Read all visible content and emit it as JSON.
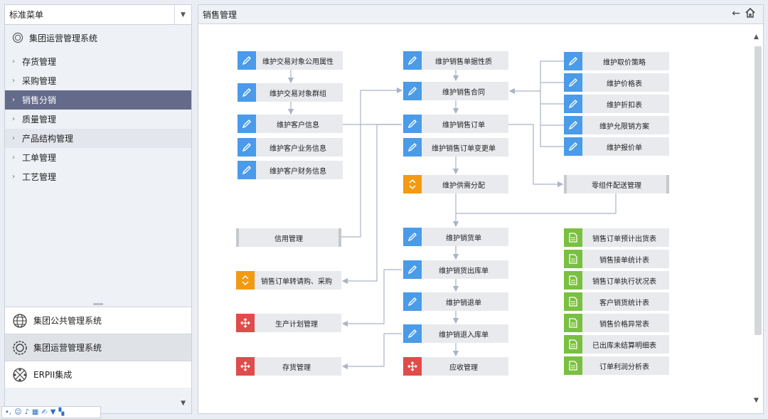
{
  "left_panel": {
    "menu_select": "标准菜单",
    "system_title": "集团运营管理系统",
    "tree": [
      {
        "label": "存货管理"
      },
      {
        "label": "采购管理"
      },
      {
        "label": "销售分销"
      },
      {
        "label": "质量管理"
      },
      {
        "label": "产品结构管理"
      },
      {
        "label": "工单管理"
      },
      {
        "label": "工艺管理"
      }
    ],
    "systems": [
      {
        "label": "集团公共管理系统",
        "icon": "globe-icon"
      },
      {
        "label": "集团运营管理系统",
        "icon": "gear-ring-icon"
      },
      {
        "label": "ERPII集成",
        "icon": "network-icon"
      }
    ]
  },
  "right_panel": {
    "title": "销售管理"
  },
  "flow": {
    "col1": [
      {
        "label": "维护交易对象公用属性",
        "icon": "edit-icon"
      },
      {
        "label": "维护交易对象群组",
        "icon": "edit-icon"
      },
      {
        "label": "维护客户信息",
        "icon": "edit-icon"
      },
      {
        "label": "维护客户业务信息",
        "icon": "edit-icon"
      },
      {
        "label": "维护客户财务信息",
        "icon": "edit-icon"
      },
      {
        "label": "信用管理",
        "icon": ""
      },
      {
        "label": "销售订单转请购、采购",
        "icon": "convert-icon"
      },
      {
        "label": "生产计划管理",
        "icon": "move-icon"
      },
      {
        "label": "存货管理",
        "icon": "move-icon"
      }
    ],
    "col2": [
      {
        "label": "维护销售单据性质",
        "icon": "edit-icon"
      },
      {
        "label": "维护销售合同",
        "icon": "edit-icon"
      },
      {
        "label": "维护销售订单",
        "icon": "edit-icon"
      },
      {
        "label": "维护销售订单变更单",
        "icon": "edit-icon"
      },
      {
        "label": "维护供需分配",
        "icon": "convert-icon"
      },
      {
        "label": "维护销货单",
        "icon": "edit-icon"
      },
      {
        "label": "维护销货出库单",
        "icon": "edit-icon"
      },
      {
        "label": "维护销退单",
        "icon": "edit-icon"
      },
      {
        "label": "维护销退入库单",
        "icon": "edit-icon"
      },
      {
        "label": "应收管理",
        "icon": "move-icon"
      }
    ],
    "col3": [
      {
        "label": "维护取价策略",
        "icon": "edit-icon"
      },
      {
        "label": "维护价格表",
        "icon": "edit-icon"
      },
      {
        "label": "维护折扣表",
        "icon": "edit-icon"
      },
      {
        "label": "维护允限销方案",
        "icon": "edit-icon"
      },
      {
        "label": "维护报价单",
        "icon": "edit-icon"
      },
      {
        "label": "零组件配送管理",
        "icon": ""
      }
    ],
    "reports": [
      {
        "label": "销售订单预计出货表",
        "icon": "report-icon"
      },
      {
        "label": "销售接单统计表",
        "icon": "report-icon"
      },
      {
        "label": "销售订单执行状况表",
        "icon": "report-icon"
      },
      {
        "label": "客户销货统计表",
        "icon": "report-icon"
      },
      {
        "label": "销售价格异常表",
        "icon": "report-icon"
      },
      {
        "label": "已出库未结算明细表",
        "icon": "report-icon"
      },
      {
        "label": "订单利润分析表",
        "icon": "report-icon"
      }
    ]
  },
  "colors": {
    "active_menu": "#646b8a",
    "edit_icon": "#4a9be8",
    "convert_icon": "#f39a13",
    "move_icon": "#e04b4b",
    "report_icon": "#7ac040",
    "connector": "#a9b4c6"
  }
}
